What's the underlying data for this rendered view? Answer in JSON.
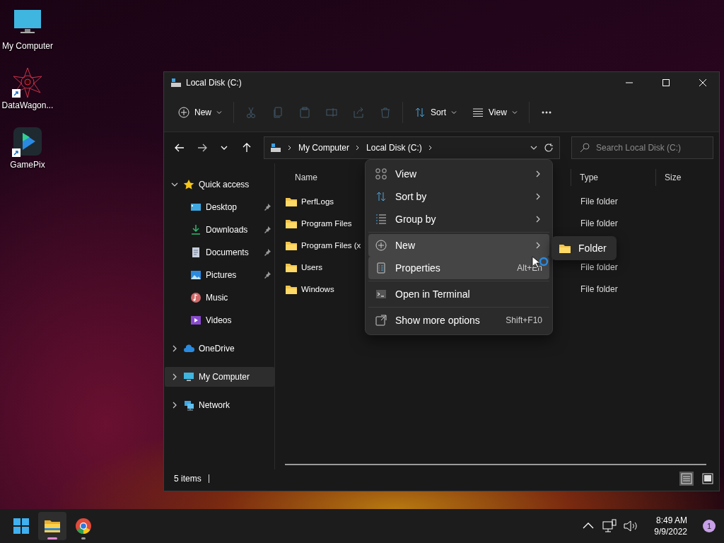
{
  "desktop_icons": [
    {
      "label": "My Computer",
      "kind": "computer",
      "shortcut": false
    },
    {
      "label": "DataWagon...",
      "kind": "starburst",
      "shortcut": true
    },
    {
      "label": "GamePix",
      "kind": "play",
      "shortcut": true
    }
  ],
  "window": {
    "title": "Local Disk (C:)"
  },
  "toolbar": [
    {
      "kind": "new",
      "label": "New",
      "disabled": false
    },
    {
      "kind": "cut",
      "disabled": true
    },
    {
      "kind": "copy",
      "disabled": true
    },
    {
      "kind": "paste",
      "disabled": true
    },
    {
      "kind": "rename",
      "disabled": true
    },
    {
      "kind": "share",
      "disabled": true
    },
    {
      "kind": "delete",
      "disabled": true
    },
    {
      "kind": "sort",
      "label": "Sort",
      "disabled": false
    },
    {
      "kind": "view",
      "label": "View",
      "disabled": false
    },
    {
      "kind": "more",
      "disabled": false
    }
  ],
  "address_bar": {
    "crumbs": [
      "My Computer",
      "Local Disk (C:)"
    ]
  },
  "search": {
    "placeholder": "Search Local Disk (C:)"
  },
  "nav_pane": [
    {
      "label": "Quick access",
      "kind": "star",
      "expanded": true,
      "selected": false,
      "children": [
        {
          "label": "Desktop",
          "kind": "desktop",
          "pinned": true
        },
        {
          "label": "Downloads",
          "kind": "downloads",
          "pinned": true
        },
        {
          "label": "Documents",
          "kind": "documents",
          "pinned": true
        },
        {
          "label": "Pictures",
          "kind": "pictures",
          "pinned": true
        },
        {
          "label": "Music",
          "kind": "music",
          "pinned": false
        },
        {
          "label": "Videos",
          "kind": "videos",
          "pinned": false
        }
      ]
    },
    {
      "label": "OneDrive",
      "kind": "cloud",
      "expanded": false,
      "selected": false
    },
    {
      "label": "My Computer",
      "kind": "computer",
      "expanded": false,
      "selected": true
    },
    {
      "label": "Network",
      "kind": "network",
      "expanded": false,
      "selected": false
    }
  ],
  "file_list": {
    "columns": [
      "Name",
      "Type",
      "Size"
    ],
    "rows": [
      {
        "name": "PerfLogs",
        "type": "File folder"
      },
      {
        "name": "Program Files",
        "type": "File folder"
      },
      {
        "name": "Program Files (x"
      },
      {
        "name": "Users",
        "type": "File folder"
      },
      {
        "name": "Windows",
        "type": "File folder"
      }
    ]
  },
  "status_bar": {
    "count": "5 items",
    "views": [
      {
        "kind": "details",
        "selected": true
      },
      {
        "kind": "tiles",
        "selected": false
      }
    ]
  },
  "context_menu": {
    "groups": [
      [
        {
          "kind": "view",
          "label": "View",
          "submenu": true,
          "highlighted": false
        },
        {
          "kind": "sort",
          "label": "Sort by",
          "submenu": true,
          "highlighted": false
        },
        {
          "kind": "group",
          "label": "Group by",
          "submenu": true,
          "highlighted": false
        }
      ],
      [
        {
          "kind": "new",
          "label": "New",
          "submenu": true,
          "highlighted": true
        },
        {
          "kind": "properties",
          "label": "Properties",
          "shortcut": "Alt+En",
          "highlighted": true
        }
      ],
      [
        {
          "kind": "terminal",
          "label": "Open in Terminal",
          "highlighted": false
        }
      ],
      [
        {
          "kind": "more",
          "label": "Show more options",
          "shortcut": "Shift+F10",
          "highlighted": false
        }
      ]
    ],
    "submenu": [
      {
        "kind": "folder",
        "label": "Folder"
      }
    ]
  },
  "taskbar": {
    "apps": [
      {
        "kind": "start",
        "running": false,
        "active": false
      },
      {
        "kind": "explorer",
        "running": true,
        "active": true
      },
      {
        "kind": "chrome",
        "running": true,
        "active": false
      }
    ],
    "clock": {
      "time": "8:49 AM",
      "date": "9/9/2022"
    },
    "notifications": "1"
  }
}
